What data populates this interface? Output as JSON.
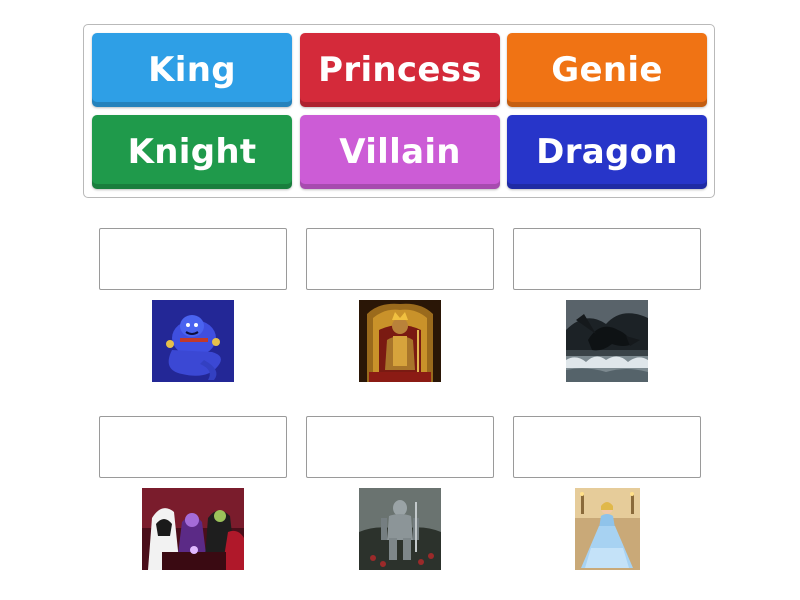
{
  "word_bank": {
    "tiles": [
      {
        "label": "King",
        "color": "#2e9fe6"
      },
      {
        "label": "Princess",
        "color": "#d42a3a"
      },
      {
        "label": "Genie",
        "color": "#f07314"
      },
      {
        "label": "Knight",
        "color": "#1f9a4b"
      },
      {
        "label": "Villain",
        "color": "#cc5cd6"
      },
      {
        "label": "Dragon",
        "color": "#2735c9"
      }
    ]
  },
  "targets": [
    {
      "image": "genie-picture",
      "answer": ""
    },
    {
      "image": "king-on-throne-picture",
      "answer": ""
    },
    {
      "image": "dragon-picture",
      "answer": ""
    },
    {
      "image": "villains-picture",
      "answer": ""
    },
    {
      "image": "knight-in-armor-picture",
      "answer": ""
    },
    {
      "image": "princess-in-blue-gown-picture",
      "answer": ""
    }
  ]
}
